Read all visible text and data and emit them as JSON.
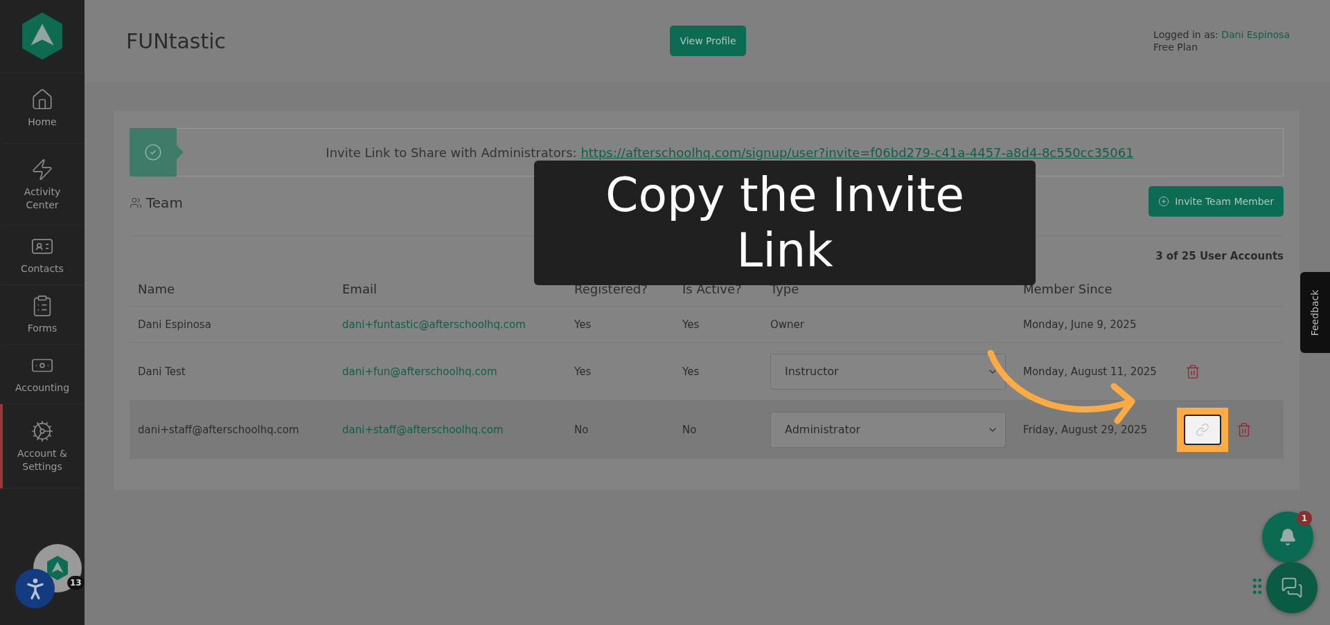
{
  "sidebar": {
    "items": [
      {
        "label": "Home",
        "selected": false
      },
      {
        "label": "Activity Center",
        "selected": false
      },
      {
        "label": "Contacts",
        "selected": false
      },
      {
        "label": "Forms",
        "selected": false
      },
      {
        "label": "Accounting",
        "selected": false
      },
      {
        "label": "Account & Settings",
        "selected": true
      }
    ],
    "avatar_badge": "13"
  },
  "header": {
    "title": "FUNtastic",
    "view_profile": "View Profile",
    "logged_in_label": "Logged in as:",
    "user": "Dani Espinosa",
    "plan": "Free Plan"
  },
  "invite_banner": {
    "label": "Invite Link to Share with Administrators:",
    "link": "https://afterschoolhq.com/signup/user?invite=f06bd279-c41a-4457-a8d4-8c550cc35061"
  },
  "team": {
    "heading": "Team",
    "invite_button": "Invite Team Member",
    "count": "3 of 25 User Accounts"
  },
  "table": {
    "columns": [
      "Name",
      "Email",
      "Registered?",
      "Is Active?",
      "Type",
      "Member Since"
    ],
    "rows": [
      {
        "name": "Dani Espinosa",
        "email": "dani+funtastic@afterschoolhq.com",
        "registered": "Yes",
        "active": "Yes",
        "type": {
          "kind": "text",
          "value": "Owner"
        },
        "member_since": "Monday, June 9, 2025",
        "copy_link": false,
        "delete": false
      },
      {
        "name": "Dani Test",
        "email": "dani+fun@afterschoolhq.com",
        "registered": "Yes",
        "active": "Yes",
        "type": {
          "kind": "select",
          "value": "Instructor"
        },
        "member_since": "Monday, August 11, 2025",
        "copy_link": false,
        "delete": true
      },
      {
        "name": "dani+staff@afterschoolhq.com",
        "email": "dani+staff@afterschoolhq.com",
        "registered": "No",
        "active": "No",
        "type": {
          "kind": "select",
          "value": "Administrator"
        },
        "member_since": "Friday, August 29, 2025",
        "copy_link": true,
        "delete": true,
        "highlighted": true
      }
    ]
  },
  "callout": {
    "text": "Copy the Invite Link"
  },
  "feedback": "Feedback",
  "notifications": {
    "badge": "1"
  }
}
